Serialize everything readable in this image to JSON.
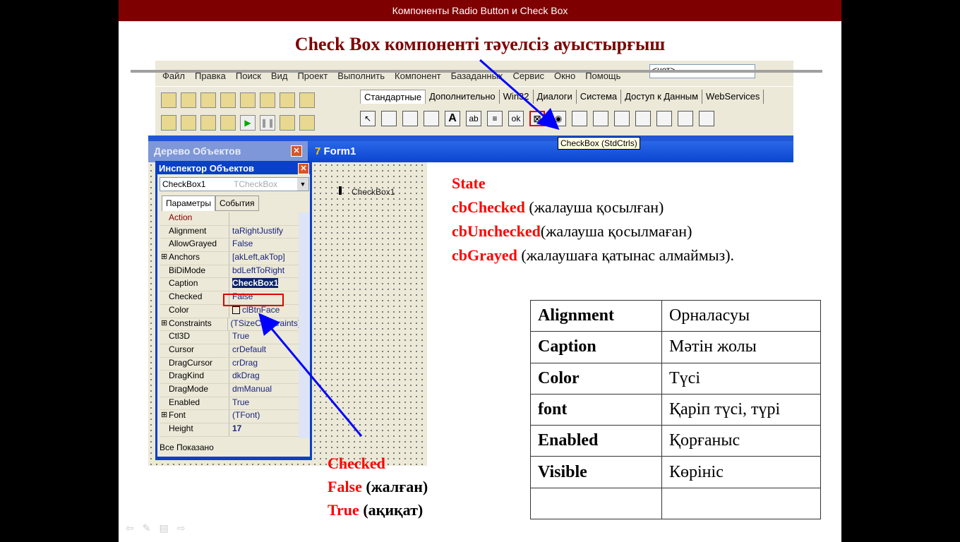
{
  "slide": {
    "header": "Компоненты  Radio Button и Check Box",
    "title": "Check Box компоненті тәуелсіз ауыстырғыш"
  },
  "ide": {
    "menu": [
      "Файл",
      "Правка",
      "Поиск",
      "Вид",
      "Проект",
      "Выполнить",
      "Компонент",
      "Базаданных",
      "Сервис",
      "Окно",
      "Помощь"
    ],
    "combo": "<нет>",
    "palette_tabs": [
      "Стандартные",
      "Дополнительно",
      "Win32",
      "Диалоги",
      "Система",
      "Доступ к Данным",
      "WebServices"
    ],
    "tooltip": "CheckBox (StdCtrls)",
    "tree_title": "Дерево Объектов",
    "form_title": "Form1",
    "checkbox_caption": "CheckBox1",
    "inspector": {
      "title": "Инспектор Объектов",
      "object": "CheckBox1",
      "type": "TCheckBox",
      "tabs": [
        "Параметры",
        "События"
      ],
      "status": "Все Показано",
      "rows": [
        {
          "name": "Action",
          "value": ""
        },
        {
          "name": "Alignment",
          "value": "taRightJustify"
        },
        {
          "name": "AllowGrayed",
          "value": "False"
        },
        {
          "name": "Anchors",
          "value": "[akLeft,akTop]",
          "expand": true
        },
        {
          "name": "BiDiMode",
          "value": "bdLeftToRight"
        },
        {
          "name": "Caption",
          "value": "CheckBox1",
          "selected": true
        },
        {
          "name": "Checked",
          "value": "False"
        },
        {
          "name": "Color",
          "value": "clBtnFace"
        },
        {
          "name": "Constraints",
          "value": "(TSizeConstraints)",
          "expand": true
        },
        {
          "name": "Ctl3D",
          "value": "True"
        },
        {
          "name": "Cursor",
          "value": "crDefault"
        },
        {
          "name": "DragCursor",
          "value": "crDrag"
        },
        {
          "name": "DragKind",
          "value": "dkDrag"
        },
        {
          "name": "DragMode",
          "value": "dmManual"
        },
        {
          "name": "Enabled",
          "value": "True"
        },
        {
          "name": "Font",
          "value": "(TFont)",
          "expand": true
        },
        {
          "name": "Height",
          "value": "17"
        }
      ]
    }
  },
  "state": {
    "label": "State",
    "items": [
      {
        "key": "cbChecked",
        "desc": " (жалауша қосылған)"
      },
      {
        "key": "cbUnchecked",
        "desc": "(жалауша қосылмаған)"
      },
      {
        "key": "cbGrayed",
        "desc": " (жалаушаға қатынас алмаймыз)."
      }
    ]
  },
  "checked": {
    "label": "Checked",
    "items": [
      {
        "key": "False",
        "desc": " (жалған)"
      },
      {
        "key": "True",
        "desc": " (ақиқат)"
      }
    ]
  },
  "table": [
    [
      "Alignment",
      "Орналасуы"
    ],
    [
      "Caption",
      "Мәтін жолы"
    ],
    [
      "Color",
      "Түсі"
    ],
    [
      "font",
      "Қаріп түсі, түрі"
    ],
    [
      "Enabled",
      "Қорғаныс"
    ],
    [
      "Visible",
      "Көрініс"
    ],
    [
      "",
      ""
    ]
  ],
  "colors": {
    "header": "#7f0000",
    "title": "#800000",
    "accent": "#ff0000",
    "arrow": "#0000ff"
  }
}
